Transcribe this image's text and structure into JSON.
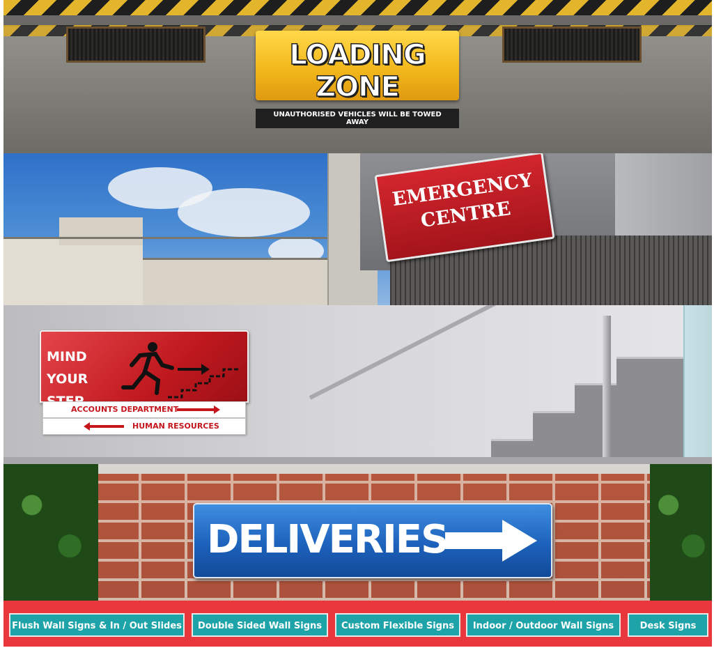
{
  "panels": {
    "loading_zone": {
      "title": "LOADING ZONE",
      "subtitle": "UNAUTHORISED VEHICLES WILL BE TOWED AWAY"
    },
    "emergency": {
      "line1": "EMERGENCY",
      "line2": "CENTRE"
    },
    "mind_step": {
      "line1": "MIND YOUR",
      "line2": "STEP",
      "direction_1": "ACCOUNTS DEPARTMENT",
      "direction_2": "HUMAN RESOURCES"
    },
    "deliveries": {
      "title": "DELIVERIES"
    }
  },
  "nav": {
    "items": [
      {
        "label": "Flush Wall Signs & In / Out Slides"
      },
      {
        "label": "Double Sided Wall Signs"
      },
      {
        "label": "Custom Flexible Signs"
      },
      {
        "label": "Indoor / Outdoor Wall Signs"
      },
      {
        "label": "Desk Signs"
      }
    ]
  },
  "colors": {
    "nav_bar": "#e8383d",
    "nav_button": "#1ea3a8",
    "loading_sign": "#f2b81c",
    "emergency_sign": "#c01c24",
    "step_sign": "#c0191f",
    "deliveries_sign": "#1d62bc"
  },
  "icons": [
    "running-man-icon",
    "stairs-icon",
    "arrow-right-icon",
    "arrow-left-icon"
  ]
}
